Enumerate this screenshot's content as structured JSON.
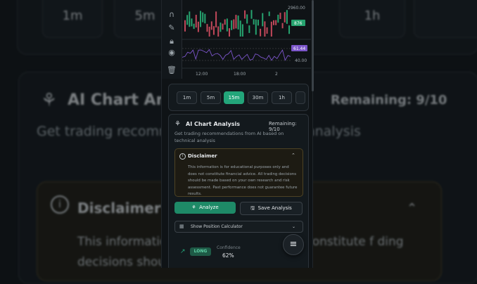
{
  "background": {
    "timeframes": [
      "1m",
      "5m",
      "1h"
    ],
    "title": "AI Chart Analy",
    "remaining": "Remaining: 9/10",
    "subtitle": "Get trading recomm                                   based on technical analysis",
    "disclaimer_title": "Disclaimer",
    "disclaimer_body": "This informatio                                   ses only and does not constitute f                             ding decisions should"
  },
  "chart": {
    "price_top": "2960.00",
    "price_tag": "876",
    "rsi_tag": "61.44",
    "rsi_level": "40.00",
    "time_labels": [
      "12:00",
      "18:00",
      "2"
    ],
    "accent_up": "#26a36f",
    "accent_down": "#c0485a",
    "rsi_color": "#7b55c9"
  },
  "toolbar": {
    "icons": [
      "magnet-icon",
      "ruler-icon",
      "lock-icon",
      "eye-icon",
      "trash-icon"
    ]
  },
  "timeframes": {
    "buttons": [
      "1m",
      "5m",
      "15m",
      "30m",
      "1h"
    ],
    "selected": "15m"
  },
  "ai_analysis": {
    "title": "AI Chart Analysis",
    "remaining": "Remaining: 9/10",
    "subtitle": "Get trading recommendations from AI based on technical analysis",
    "disclaimer": {
      "title": "Disclaimer",
      "body": "This information is for educational purposes only and does not constitute financial advice. All trading decisions should be made based on your own research and risk assessment. Past performance does not guarantee future results."
    },
    "analyze_label": "Analyze",
    "save_label": "Save Analysis",
    "calculator_label": "Show Position Calculator",
    "signal": "LONG",
    "confidence_label": "Confidence",
    "confidence_value": "62%"
  }
}
